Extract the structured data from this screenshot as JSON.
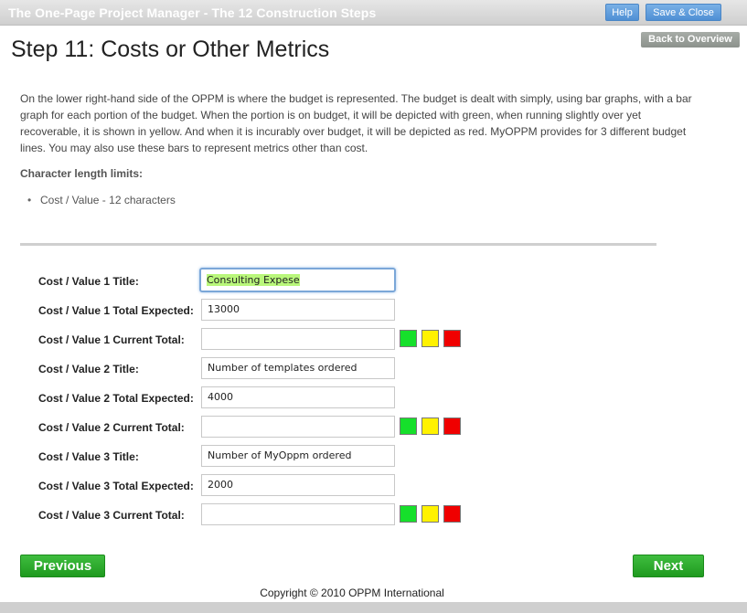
{
  "app": {
    "title": "The One-Page Project Manager - The 12 Construction Steps",
    "help_label": "Help",
    "save_close_label": "Save & Close",
    "back_label": "Back to Overview"
  },
  "page": {
    "heading": "Step 11: Costs or Other Metrics",
    "intro": "On the lower right-hand side of the OPPM is where the budget is represented. The budget is dealt with simply, using bar graphs, with a bar graph for each portion of the budget. When the portion is on budget, it will be depicted with green, when running slightly over yet recoverable, it is shown in yellow. And when it is incurably over budget, it will be depicted as red. MyOPPM provides for 3 different budget lines. You may also use these bars to represent metrics other than cost.",
    "limits_heading": "Character length limits:",
    "limits": [
      "Cost / Value - 12 characters"
    ]
  },
  "form": {
    "fields": [
      {
        "label": "Cost / Value 1 Title:",
        "value": "Consulting Expese"
      },
      {
        "label": "Cost / Value 1 Total Expected:",
        "value": "13000"
      },
      {
        "label": "Cost / Value 1 Current Total:",
        "value": ""
      },
      {
        "label": "Cost / Value 2 Title:",
        "value": "Number of templates ordered"
      },
      {
        "label": "Cost / Value 2 Total Expected:",
        "value": "4000"
      },
      {
        "label": "Cost / Value 2 Current Total:",
        "value": ""
      },
      {
        "label": "Cost / Value 3 Title:",
        "value": "Number of MyOppm ordered"
      },
      {
        "label": "Cost / Value 3 Total Expected:",
        "value": "2000"
      },
      {
        "label": "Cost / Value 3 Current Total:",
        "value": ""
      }
    ],
    "status_colors": {
      "green": "#16e02b",
      "yellow": "#fff200",
      "red": "#f00000"
    }
  },
  "nav": {
    "previous_label": "Previous",
    "next_label": "Next"
  },
  "footer": {
    "copyright": "Copyright © 2010 OPPM International"
  }
}
